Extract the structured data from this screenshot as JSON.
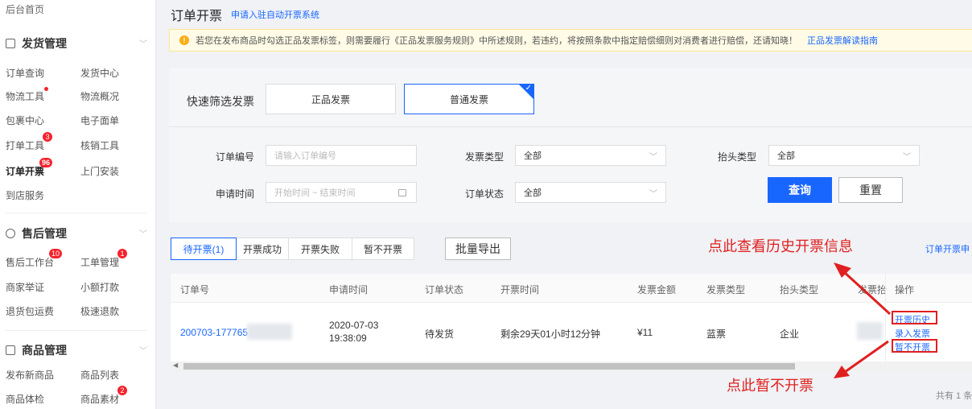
{
  "sidebar": {
    "home": "后台首页",
    "groups": [
      {
        "title": "发货管理",
        "items": [
          {
            "label": "订单查询"
          },
          {
            "label": "发货中心"
          },
          {
            "label": "物流工具"
          },
          {
            "label": "物流概况"
          },
          {
            "label": "包裹中心"
          },
          {
            "label": "电子面单"
          },
          {
            "label": "打单工具",
            "badge": "3"
          },
          {
            "label": "核销工具"
          },
          {
            "label": "订单开票",
            "badge": "96"
          },
          {
            "label": "上门安装"
          },
          {
            "label": "到店服务"
          }
        ]
      },
      {
        "title": "售后管理",
        "items": [
          {
            "label": "售后工作台",
            "badge": "10"
          },
          {
            "label": "工单管理",
            "badge": "1"
          },
          {
            "label": "商家举证"
          },
          {
            "label": "小额打款"
          },
          {
            "label": "退货包运费"
          },
          {
            "label": "极速退款"
          }
        ]
      },
      {
        "title": "商品管理",
        "items": [
          {
            "label": "发布新商品"
          },
          {
            "label": "商品列表"
          },
          {
            "label": "商品体检"
          },
          {
            "label": "商品素材",
            "badge": "2"
          }
        ]
      }
    ]
  },
  "header": {
    "title": "订单开票",
    "link": "申请入驻自动开票系统"
  },
  "notice": {
    "text": "若您在发布商品时勾选正品发票标签，则需要履行《正品发票服务规则》中所述规则，若违约，将按照条款中指定赔偿细则对消费者进行赔偿，还请知晓！",
    "guide": "正品发票解读指南"
  },
  "filters": {
    "quick_label": "快速筛选发票",
    "quick_options": [
      "正品发票",
      "普通发票"
    ],
    "order_no_label": "订单编号",
    "order_no_placeholder": "请输入订单编号",
    "invoice_type_label": "发票类型",
    "invoice_type_value": "全部",
    "title_type_label": "抬头类型",
    "title_type_value": "全部",
    "apply_time_label": "申请时间",
    "apply_time_placeholder": "开始时间 ~ 结束时间",
    "order_status_label": "订单状态",
    "order_status_value": "全部",
    "query": "查询",
    "reset": "重置"
  },
  "tabs": [
    "待开票(1)",
    "开票成功",
    "开票失败",
    "暂不开票"
  ],
  "export": "批量导出",
  "right_link": "订单开票申",
  "annotations": {
    "history": "点此查看历史开票信息",
    "pause": "点此暂不开票"
  },
  "table": {
    "headers": [
      "订单号",
      "申请时间",
      "订单状态",
      "开票时间",
      "发票金额",
      "发票类型",
      "抬头类型",
      "发票抬",
      "操作"
    ],
    "row": {
      "order_no": "200703-177765",
      "apply_date": "2020-07-03",
      "apply_time": "19:38:09",
      "status": "待发货",
      "remaining": "剩余29天01小时12分钟",
      "amount": "¥11",
      "invoice_type": "蓝票",
      "title_type": "企业",
      "ops": [
        "开票历史",
        "录入发票",
        "暂不开票"
      ]
    }
  },
  "total": "共有 1 条",
  "colors": {
    "accent": "#1966ff",
    "annotation": "#e02020",
    "badge": "#f5222d"
  }
}
